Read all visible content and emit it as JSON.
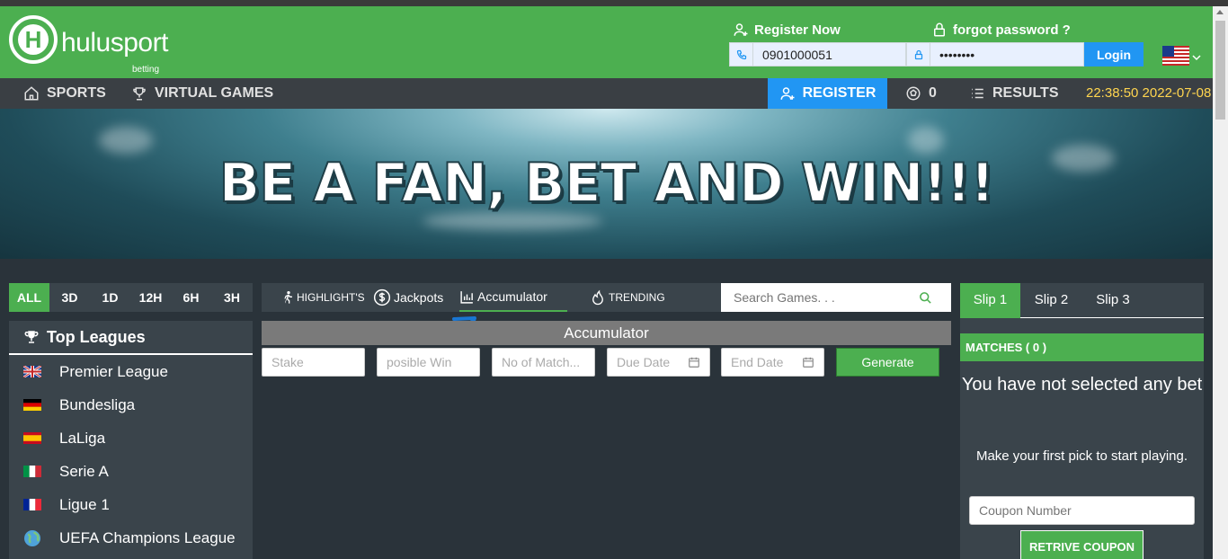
{
  "brand": {
    "name": "hulusport",
    "sub": "betting",
    "logo_letter": "H"
  },
  "header": {
    "register_now": "Register Now",
    "forgot_password": "forgot password ?",
    "phone_value": "0901000051",
    "password_value": "••••••••",
    "login_label": "Login",
    "language": "us-flag"
  },
  "nav": {
    "sports": "SPORTS",
    "virtual_games": "VIRTUAL GAMES",
    "register": "REGISTER",
    "ball_count": "0",
    "results": "RESULTS",
    "clock": "22:38:50 2022-07-08"
  },
  "banner": {
    "text": "BE A FAN, BET AND WIN!!!"
  },
  "time_filters": [
    "ALL",
    "3D",
    "1D",
    "12H",
    "6H",
    "3H"
  ],
  "active_time_filter": "ALL",
  "top_leagues": {
    "title": "Top Leagues",
    "items": [
      {
        "label": "Premier League",
        "flag": "england"
      },
      {
        "label": "Bundesliga",
        "flag": "germany"
      },
      {
        "label": "LaLiga",
        "flag": "spain"
      },
      {
        "label": "Serie A",
        "flag": "italy"
      },
      {
        "label": "Ligue 1",
        "flag": "france"
      },
      {
        "label": "UEFA Champions League",
        "flag": "globe"
      }
    ]
  },
  "center_tabs": {
    "highlights": "HIGHLIGHT'S",
    "jackpots": "Jackpots",
    "accumulator": "Accumulator",
    "trending": "TRENDING",
    "active": "Accumulator"
  },
  "search": {
    "placeholder": "Search Games. . ."
  },
  "accumulator": {
    "title": "Accumulator",
    "stake_placeholder": "Stake",
    "possible_win_placeholder": "posible Win",
    "no_of_match_placeholder": "No of Match...",
    "due_date_placeholder": "Due Date",
    "end_date_placeholder": "End Date",
    "generate_label": "Generate"
  },
  "slip": {
    "tabs": [
      "Slip 1",
      "Slip 2",
      "Slip 3"
    ],
    "active": "Slip 1",
    "matches_label": "MATCHES ( 0 )",
    "empty_title": "You have not selected any bet",
    "empty_sub": "Make your first pick to start playing.",
    "coupon_placeholder": "Coupon Number",
    "retrive_label": "RETRIVE COUPON"
  },
  "colors": {
    "brand_green": "#4caf50",
    "accent_blue": "#2196f3",
    "clock_yellow": "#ffd54f",
    "panel": "#3a444b"
  }
}
